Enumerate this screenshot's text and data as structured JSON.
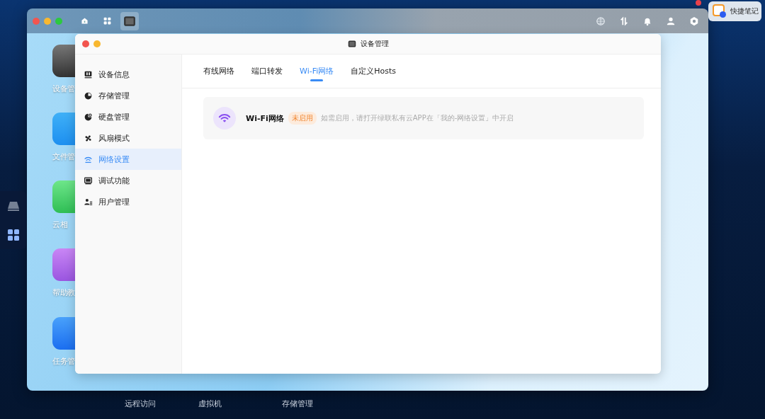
{
  "desktop": {
    "app_icons": [
      {
        "label": "设备管"
      },
      {
        "label": "文件管"
      },
      {
        "label": "云相"
      },
      {
        "label": "帮助教"
      },
      {
        "label": "任务管"
      }
    ],
    "dock_items": [
      {
        "selected": false
      },
      {
        "selected": true
      }
    ]
  },
  "app_window": {
    "toolbar_apps": [
      {
        "selected": false
      },
      {
        "selected": false
      },
      {
        "selected": true
      }
    ]
  },
  "quick_note": {
    "label": "快捷笔记"
  },
  "taskbar": [
    "远程访问",
    "虚拟机",
    "存储管理"
  ],
  "dialog": {
    "title": "设备管理",
    "sidebar": {
      "items": [
        {
          "label": "设备信息",
          "selected": false
        },
        {
          "label": "存储管理",
          "selected": false
        },
        {
          "label": "硬盘管理",
          "selected": false
        },
        {
          "label": "风扇模式",
          "selected": false
        },
        {
          "label": "网络设置",
          "selected": true
        },
        {
          "label": "调试功能",
          "selected": false
        },
        {
          "label": "用户管理",
          "selected": false
        }
      ]
    },
    "tabs": [
      {
        "label": "有线网络",
        "selected": false
      },
      {
        "label": "端口转发",
        "selected": false
      },
      {
        "label": "Wi-Fi网络",
        "selected": true
      },
      {
        "label": "自定义Hosts",
        "selected": false
      }
    ],
    "wifi_card": {
      "title": "Wi-Fi网络",
      "status": "未启用",
      "hint": "如需启用，请打开绿联私有云APP在「我的-网络设置」中开启"
    }
  }
}
